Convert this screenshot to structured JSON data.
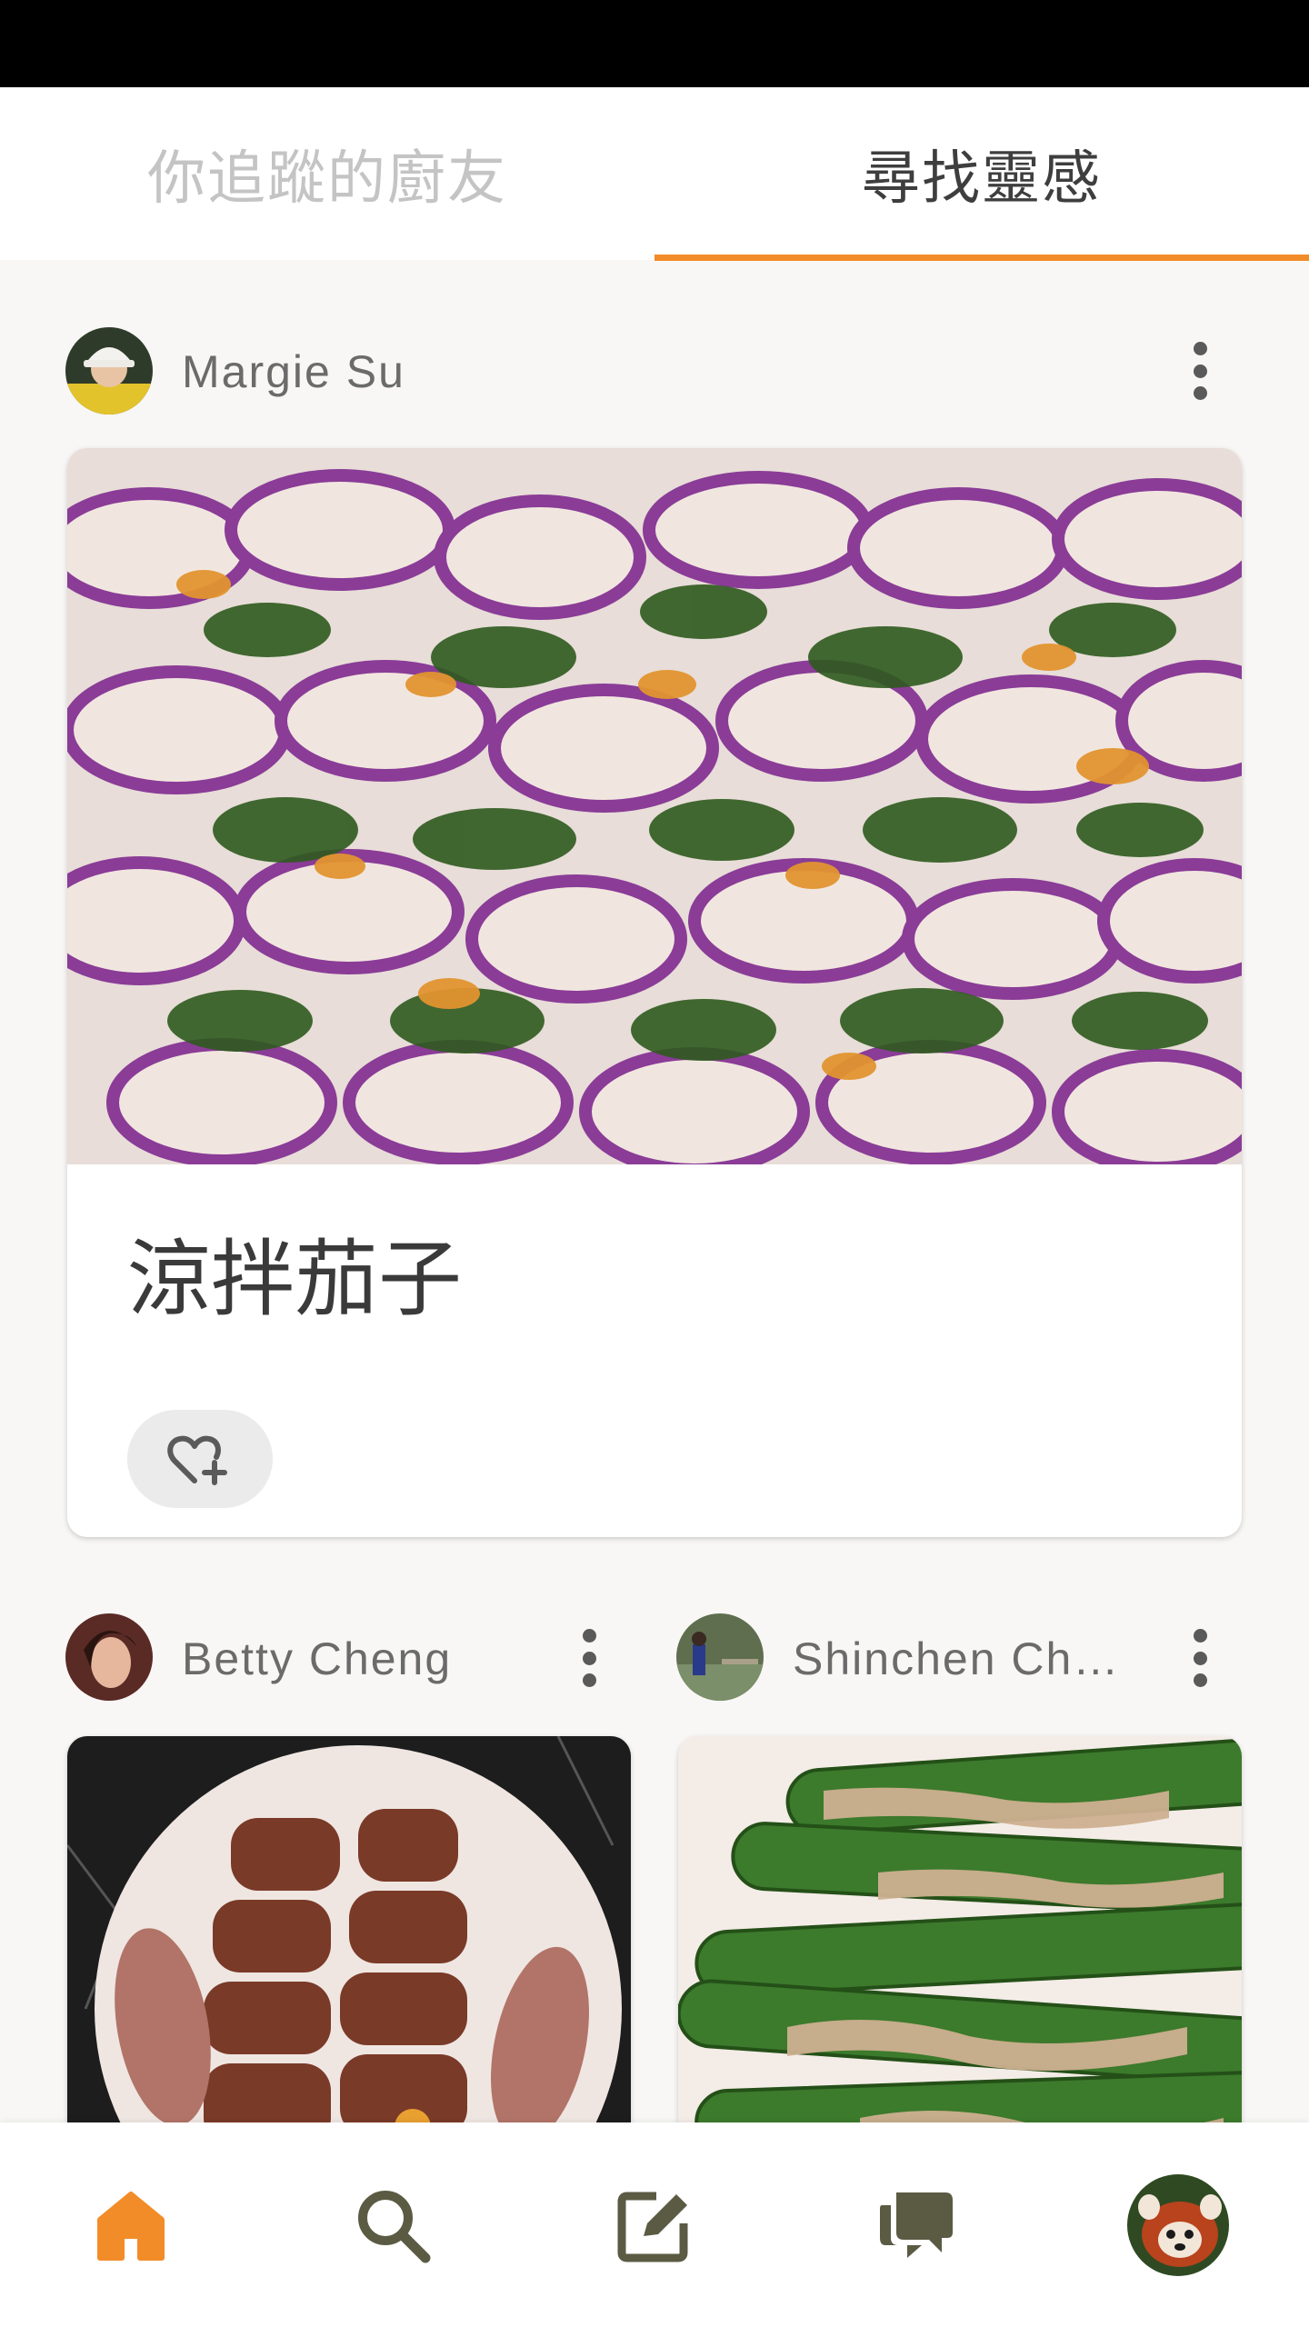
{
  "tabs": {
    "following": "你追蹤的廚友",
    "inspiration": "尋找靈感"
  },
  "colors": {
    "accent": "#f28c28",
    "icon": "#5b5b44",
    "text": "#3e3e3e"
  },
  "feed": {
    "featured": {
      "author": "Margie Su",
      "title": "涼拌茄子",
      "save_icon": "heart-plus-icon"
    },
    "cards": [
      {
        "author": "Betty Cheng"
      },
      {
        "author": "Shinchen Ch…"
      }
    ]
  },
  "bottom_nav": {
    "items": [
      "home-icon",
      "search-icon",
      "edit-icon",
      "chat-icon",
      "profile-avatar"
    ]
  }
}
